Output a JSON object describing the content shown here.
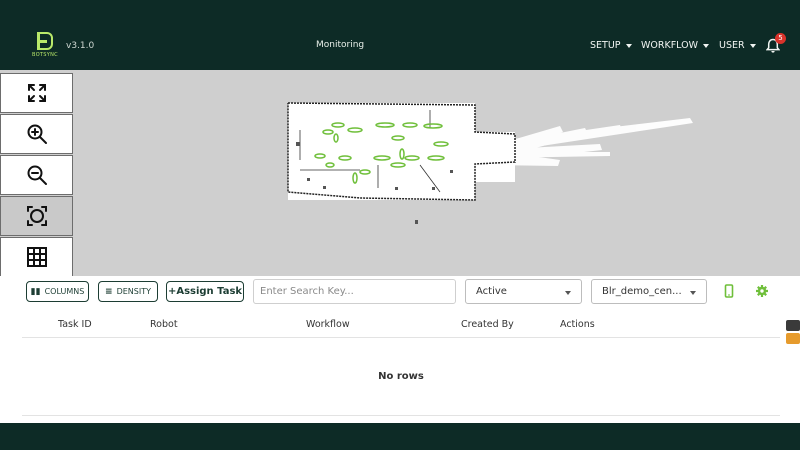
{
  "header": {
    "brand": "BOTSYNC",
    "version": "v3.1.0",
    "title": "Monitoring",
    "nav": [
      {
        "label": "SETUP"
      },
      {
        "label": "WORKFLOW"
      },
      {
        "label": "USER"
      }
    ],
    "notifications_count": "5"
  },
  "map_tools": [
    {
      "icon": "expand-icon"
    },
    {
      "icon": "zoom-in-icon"
    },
    {
      "icon": "zoom-out-icon"
    },
    {
      "icon": "recenter-icon"
    },
    {
      "icon": "grid-icon"
    }
  ],
  "toolbar": {
    "columns_label": "COLUMNS",
    "density_label": "DENSITY",
    "assign_label": "+Assign Task",
    "search_placeholder": "Enter Search Key...",
    "status_value": "Active",
    "site_value": "Blr_demo_cen..."
  },
  "table": {
    "columns": [
      "Task ID",
      "Robot",
      "Workflow",
      "Created By",
      "Actions"
    ],
    "empty_text": "No rows"
  },
  "colors": {
    "header_bg": "#0d2b26",
    "accent_green": "#6fbf3a",
    "map_bg": "#cfcfcf"
  }
}
